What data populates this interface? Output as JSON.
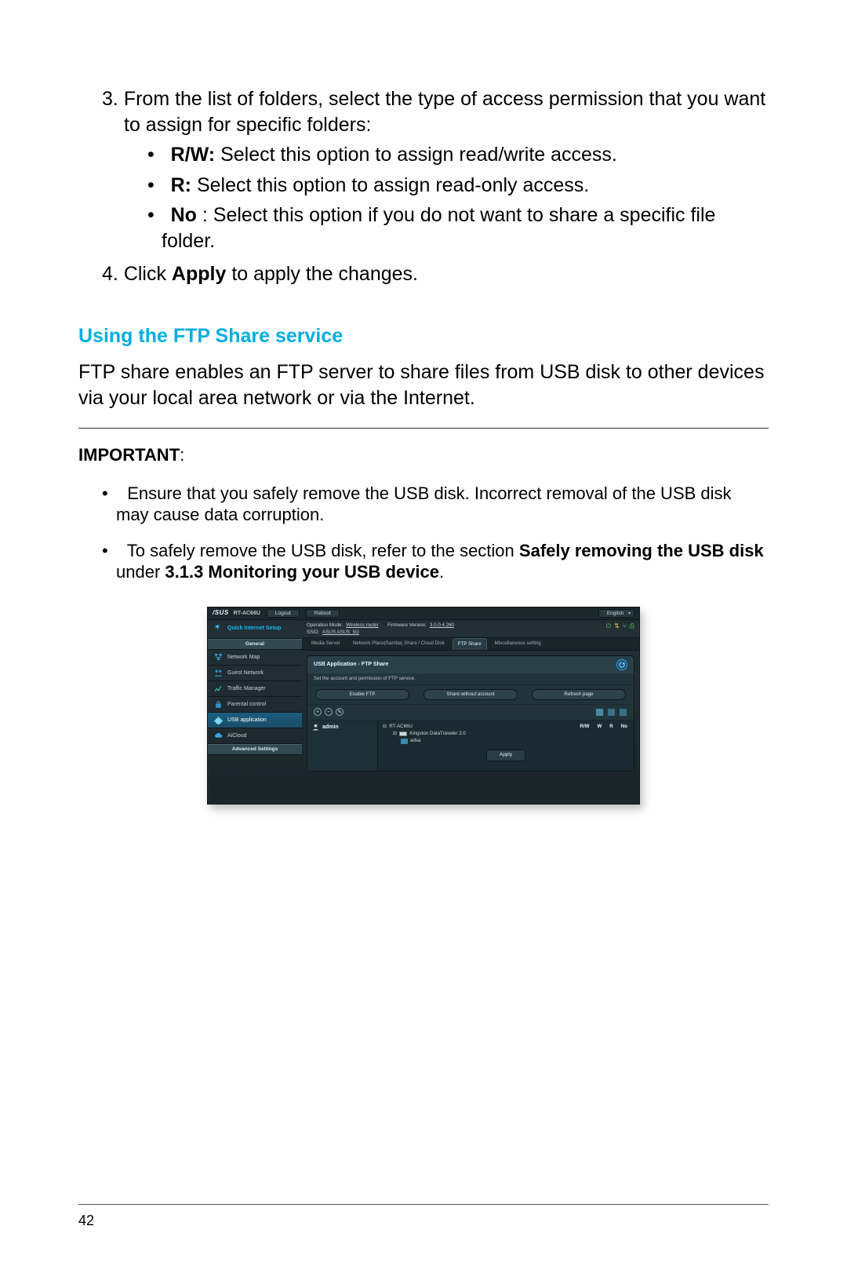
{
  "list": {
    "item3_num": "3.",
    "item3_text": "From the list of folders, select the type of access permission that you want to assign for specific folders:",
    "sub_bullet": "•",
    "rw_bold": "R/W:",
    "rw_rest": "  Select this option to assign read/write access.",
    "r_bold": "R:",
    "r_rest": "  Select this option to assign read-only access.",
    "no_bold": "No",
    "no_rest": ":   Select this option if you do not want to share a specific file folder.",
    "item4_num": "4.",
    "item4_pre": "Click ",
    "item4_bold": "Apply",
    "item4_post": " to apply the changes."
  },
  "heading": "Using the FTP Share service",
  "para": "FTP share enables an FTP server to share files from USB disk to other devices via your local area network or via the Internet.",
  "important": {
    "label": "IMPORTANT",
    "colon": ":",
    "bullet": "•",
    "i1": "Ensure that you safely remove the USB disk. Incorrect removal of the USB disk may cause data corruption.",
    "i2_pre": "To safely remove the USB disk, refer to the section ",
    "i2_b1": "Safely removing the USB disk",
    "i2_mid": " under ",
    "i2_b2": "3.1.3 Monitoring your USB device",
    "i2_post": "."
  },
  "router": {
    "logo": "/SUS",
    "model": "RT-AC66U",
    "logout": "Logout",
    "reboot": "Reboot",
    "lang": "English",
    "opmode_label": "Operation Mode:",
    "opmode_value": "Wireless router",
    "fw_label": "Firmware Version:",
    "fw_value": "3.0.0.4.260",
    "ssid_label": "SSID:",
    "ssid_value": "ASUS  ASUS_5G",
    "qis": "Quick Internet Setup",
    "sec_general": "General",
    "nav": {
      "map": "Network Map",
      "guest": "Guest Network",
      "traffic": "Traffic Manager",
      "parental": "Parental control",
      "usb": "USB application",
      "aicloud": "AiCloud"
    },
    "sec_adv": "Advanced Settings",
    "tabs": {
      "t1": "Media Server",
      "t2": "Network Place(Samba) Share / Cloud Disk",
      "t3": "FTP Share",
      "t4": "Miscellaneous setting"
    },
    "panel": {
      "title": "USB Application - FTP Share",
      "sub": "Set the account and permission of FTP service.",
      "b1": "Enable FTP",
      "b2": "Share without account",
      "b3": "Refresh page",
      "user": "admin",
      "devname": "RT-AC66U",
      "drive": "Kingston DataTraveler 2.0",
      "folder": "adsa",
      "col_rw": "R/W",
      "col_w": "W",
      "col_r": "R",
      "col_no": "No",
      "apply": "Apply"
    }
  },
  "page_number": "42"
}
